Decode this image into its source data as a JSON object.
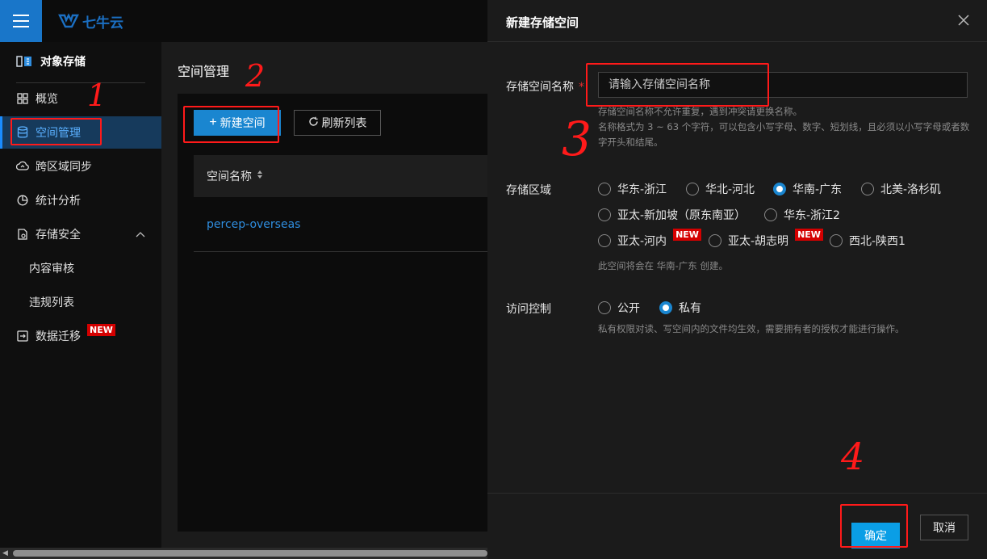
{
  "brand": {
    "logo_text": "七牛云",
    "accent": "#1a86d0"
  },
  "sidebar": {
    "section_title": "对象存储",
    "items": [
      {
        "label": "概览",
        "icon": "grid-icon"
      },
      {
        "label": "空间管理",
        "icon": "database-icon",
        "active": true
      },
      {
        "label": "跨区域同步",
        "icon": "cloud-sync-icon"
      },
      {
        "label": "统计分析",
        "icon": "pie-chart-icon"
      },
      {
        "label": "存储安全",
        "icon": "shield-doc-icon",
        "expanded": true
      },
      {
        "label": "数据迁移",
        "icon": "migrate-icon",
        "badge": "NEW"
      }
    ],
    "subitems": [
      {
        "label": "内容审核"
      },
      {
        "label": "违规列表"
      }
    ]
  },
  "main": {
    "title": "空间管理",
    "new_button": "新建空间",
    "refresh_button": "刷新列表",
    "table": {
      "column": "空间名称",
      "rows": [
        {
          "name": "percep-overseas"
        }
      ]
    }
  },
  "drawer": {
    "title": "新建存储空间",
    "name_field": {
      "label": "存储空间名称",
      "required_mark": "*",
      "placeholder": "请输入存储空间名称",
      "value": "",
      "hint1": "存储空间名称不允许重复，遇到冲突请更换名称。",
      "hint2": "名称格式为 3 ~ 63 个字符，可以包含小写字母、数字、短划线，且必须以小写字母或者数字开头和结尾。"
    },
    "region": {
      "label": "存储区域",
      "options": [
        {
          "label": "华东-浙江"
        },
        {
          "label": "华北-河北"
        },
        {
          "label": "华南-广东",
          "checked": true
        },
        {
          "label": "北美-洛杉矶"
        },
        {
          "label": "亚太-新加坡（原东南亚）"
        },
        {
          "label": "华东-浙江2"
        },
        {
          "label": "亚太-河内",
          "badge": "NEW"
        },
        {
          "label": "亚太-胡志明",
          "badge": "NEW"
        },
        {
          "label": "西北-陕西1"
        }
      ],
      "hint": "此空间将会在 华南-广东 创建。"
    },
    "access": {
      "label": "访问控制",
      "options": [
        {
          "label": "公开"
        },
        {
          "label": "私有",
          "checked": true
        }
      ],
      "hint": "私有权限对读、写空间内的文件均生效，需要拥有者的授权才能进行操作。"
    },
    "confirm_button": "确定",
    "cancel_button": "取消"
  },
  "annotations": [
    "1",
    "2",
    "3",
    "4"
  ]
}
